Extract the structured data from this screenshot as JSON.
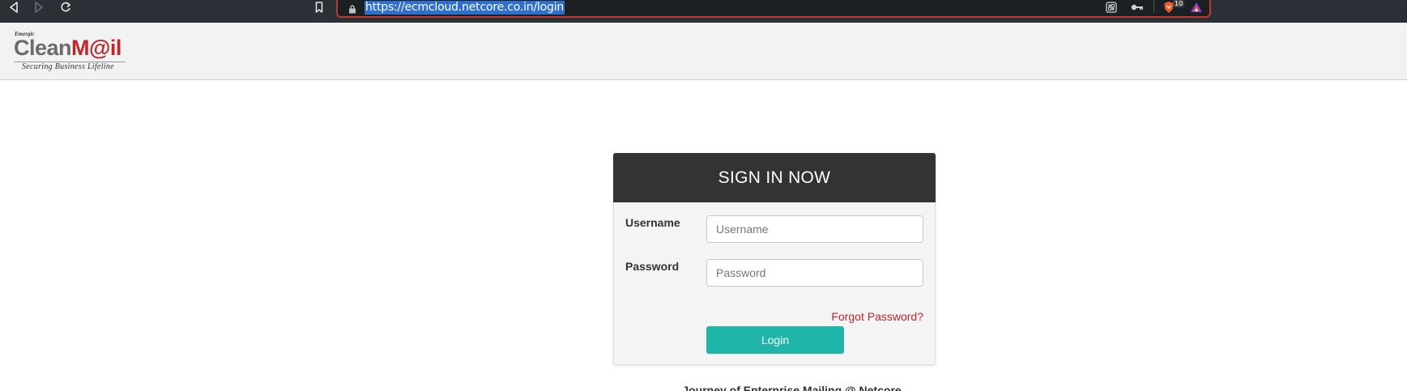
{
  "browser": {
    "url": "https://ecmcloud.netcore.co.in/login",
    "brave_badge_count": "10",
    "icons": [
      "back-icon",
      "forward-icon",
      "reload-icon",
      "bookmark-icon",
      "lock-icon",
      "qr-icon",
      "key-icon",
      "brave-shield-icon",
      "brave-rewards-icon"
    ],
    "colors": {
      "url_highlight": "#2f6fd0",
      "urlbar_border": "#c0392b"
    }
  },
  "header": {
    "logo": {
      "small_text": "Emergic",
      "brand_part1": "Clean",
      "brand_part2": "M@il",
      "tagline": "Securing  Business  Lifeline"
    }
  },
  "login": {
    "title": "SIGN IN NOW",
    "username_label": "Username",
    "username_placeholder": "Username",
    "username_value": "",
    "password_label": "Password",
    "password_placeholder": "Password",
    "password_value": "",
    "forgot_password": "Forgot Password?",
    "login_button": "Login",
    "colors": {
      "header_bg": "#333333",
      "button_bg": "#1fb5a8",
      "link_color": "#c0272d"
    }
  },
  "footer": {
    "text": "Journey of Enterprise Mailing @ Netcore"
  }
}
